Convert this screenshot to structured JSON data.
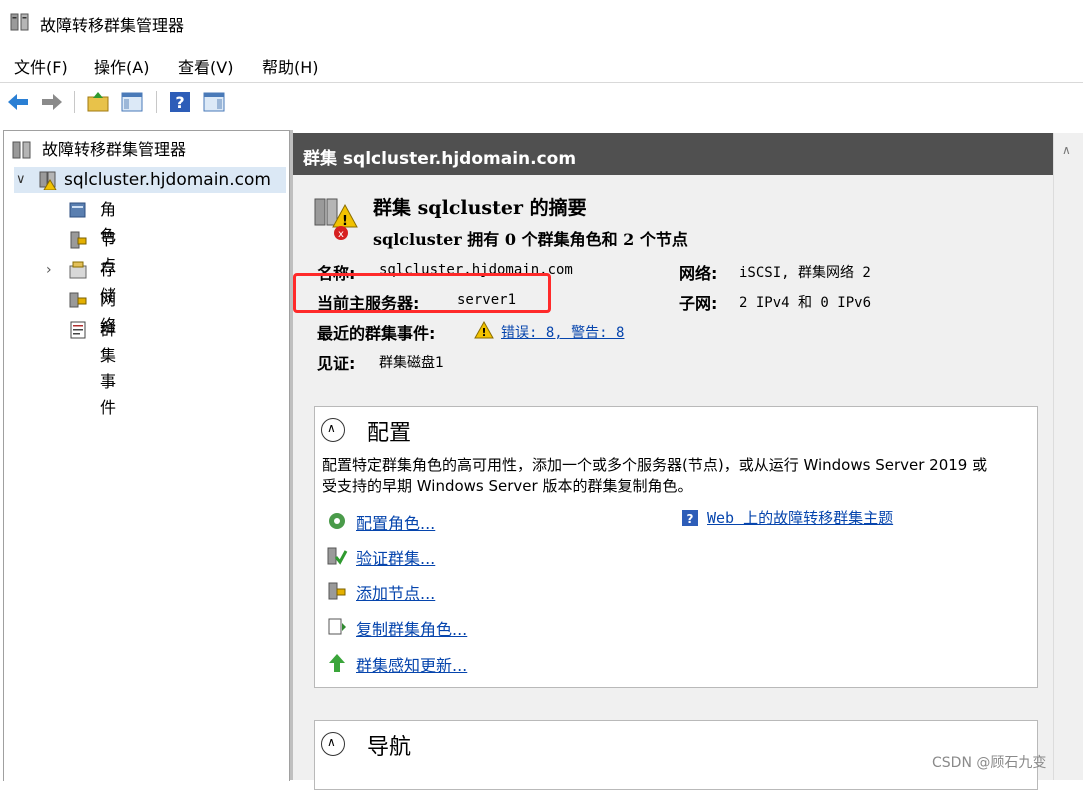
{
  "window": {
    "title": "故障转移群集管理器"
  },
  "menu": [
    "文件(F)",
    "操作(A)",
    "查看(V)",
    "帮助(H)"
  ],
  "tree": {
    "root": "故障转移群集管理器",
    "cluster": "sqlcluster.hjdomain.com",
    "children": [
      "角色",
      "节点",
      "存储",
      "网络",
      "群集事件"
    ]
  },
  "content": {
    "header": "群集 sqlcluster.hjdomain.com",
    "summary_title": "群集 sqlcluster 的摘要",
    "summary_sub": "sqlcluster 拥有 0 个群集角色和 2 个节点",
    "name_label": "名称:",
    "name_value": "sqlcluster.hjdomain.com",
    "network_label": "网络:",
    "network_value": "iSCSI, 群集网络 2",
    "host_label": "当前主服务器:",
    "host_value": "server1",
    "subnet_label": "子网:",
    "subnet_value": "2 IPv4 和 0 IPv6",
    "events_label": "最近的群集事件:",
    "events_value": "错误: 8, 警告: 8",
    "witness_label": "见证:",
    "witness_value": "群集磁盘1"
  },
  "config": {
    "title": "配置",
    "desc": "配置特定群集角色的高可用性，添加一个或多个服务器(节点)，或从运行 Windows Server 2019 或受支持的早期 Windows Server 版本的群集复制角色。",
    "actions": [
      "配置角色...",
      "验证群集...",
      "添加节点...",
      "复制群集角色...",
      "群集感知更新..."
    ],
    "web_link": "Web 上的故障转移群集主题"
  },
  "nav": {
    "title": "导航"
  },
  "watermark": "CSDN @顾石九变"
}
